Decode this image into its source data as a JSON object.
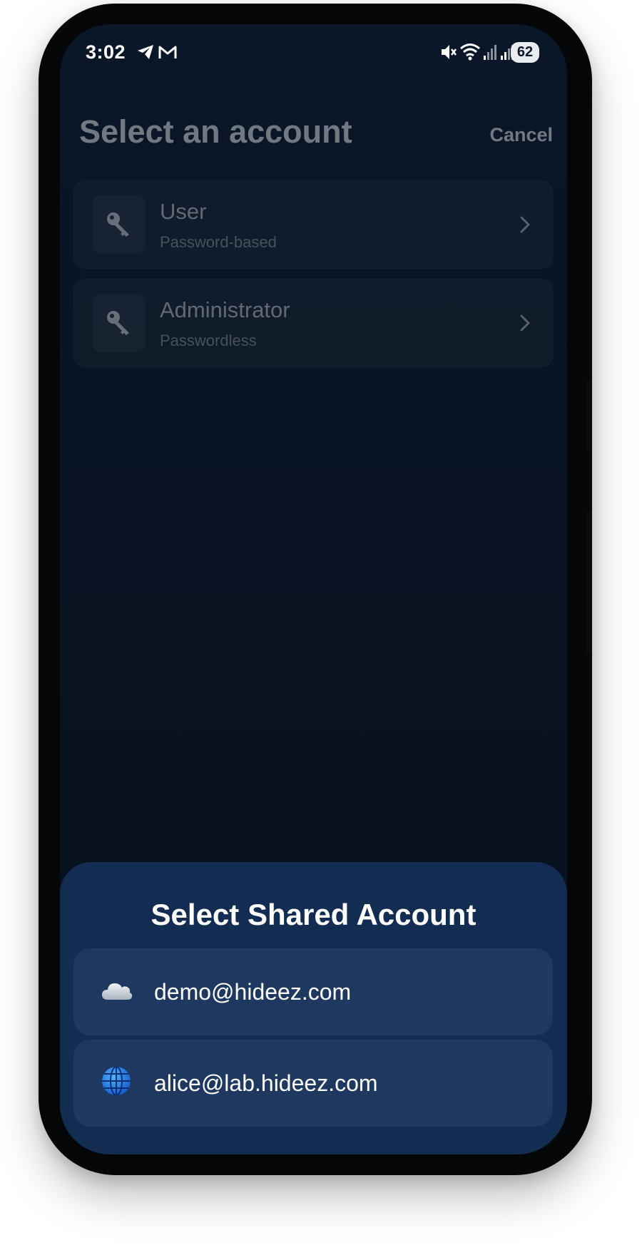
{
  "status_bar": {
    "time": "3:02",
    "battery": "62",
    "icons": [
      "telegram-icon",
      "gmail-icon",
      "mute-icon",
      "wifi-icon",
      "signal-icon",
      "signal-icon"
    ]
  },
  "header": {
    "title": "Select an account",
    "cancel_label": "Cancel"
  },
  "accounts": [
    {
      "name": "User",
      "type": "Password-based",
      "icon": "key-icon"
    },
    {
      "name": "Administrator",
      "type": "Passwordless",
      "icon": "key-icon"
    }
  ],
  "sheet": {
    "title": "Select Shared Account",
    "items": [
      {
        "label": "demo@hideez.com",
        "icon": "cloud-icon"
      },
      {
        "label": "alice@lab.hideez.com",
        "icon": "globe-icon"
      }
    ]
  },
  "colors": {
    "background": "#081222",
    "sheet": "#132c52",
    "sheet_item": "#1f3860"
  }
}
